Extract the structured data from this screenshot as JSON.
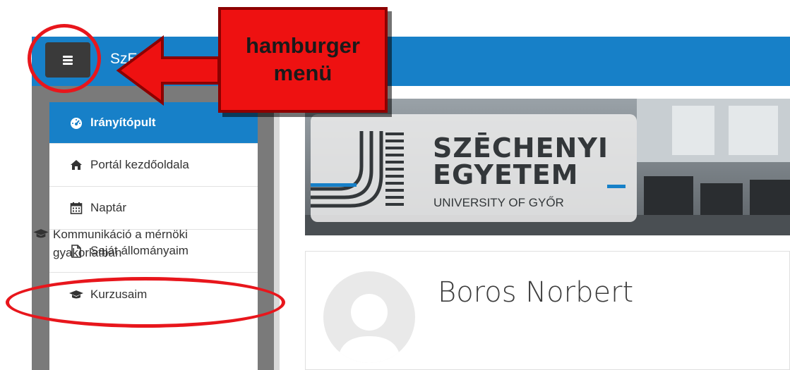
{
  "navbar": {
    "site_name": "SzE",
    "accent_color": "#1780c8",
    "hamburger_icon": "bars-icon"
  },
  "callout": {
    "text": "hamburger\nmenü",
    "color": "#ee1111"
  },
  "sidebar": {
    "items": [
      {
        "label": "Irányítópult",
        "icon": "dashboard-icon",
        "active": true
      },
      {
        "label": "Portál kezdőoldala",
        "icon": "home-icon"
      },
      {
        "label": "Naptár",
        "icon": "calendar-icon"
      },
      {
        "label": "Saját állományaim",
        "icon": "file-icon"
      },
      {
        "label": "Kurzusaim",
        "icon": "graduation-cap-icon"
      }
    ],
    "course": {
      "label": "Kommunikáció a mérnöki gyakorlatban",
      "icon": "graduation-cap-icon"
    }
  },
  "banner": {
    "brand_line1": "SZĒCHENYI",
    "brand_line2": "EGYETEM",
    "brand_line3": "UNIVERSITY OF GYŐR"
  },
  "profile": {
    "name": "Boros Norbert"
  }
}
